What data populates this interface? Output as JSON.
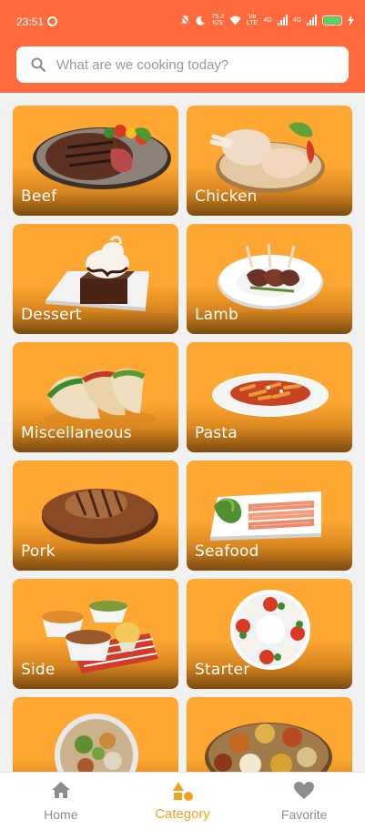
{
  "status": {
    "time": "23:51",
    "net_speed_top": "75.2",
    "net_speed_bottom": "K/S",
    "volte_top": "Vo",
    "volte_bottom": "LTE",
    "sim1": "4G",
    "sim2": "4G"
  },
  "search": {
    "placeholder": "What are we cooking today?"
  },
  "categories": [
    {
      "label": "Beef",
      "icon": "beef-steak"
    },
    {
      "label": "Chicken",
      "icon": "chicken-legs"
    },
    {
      "label": "Dessert",
      "icon": "brownie-sundae"
    },
    {
      "label": "Lamb",
      "icon": "lamb-chops"
    },
    {
      "label": "Miscellaneous",
      "icon": "tacos"
    },
    {
      "label": "Pasta",
      "icon": "penne-pasta"
    },
    {
      "label": "Pork",
      "icon": "pork-chop"
    },
    {
      "label": "Seafood",
      "icon": "salmon-platter"
    },
    {
      "label": "Side",
      "icon": "side-bowls"
    },
    {
      "label": "Starter",
      "icon": "caprese-plate"
    },
    {
      "label": "",
      "icon": "bowl-salad"
    },
    {
      "label": "",
      "icon": "thali-platter"
    }
  ],
  "nav": {
    "home": "Home",
    "category": "Category",
    "favorite": "Favorite"
  },
  "colors": {
    "header": "#ff6b3d",
    "card": "#ffa733",
    "active_tab": "#f0a323"
  }
}
